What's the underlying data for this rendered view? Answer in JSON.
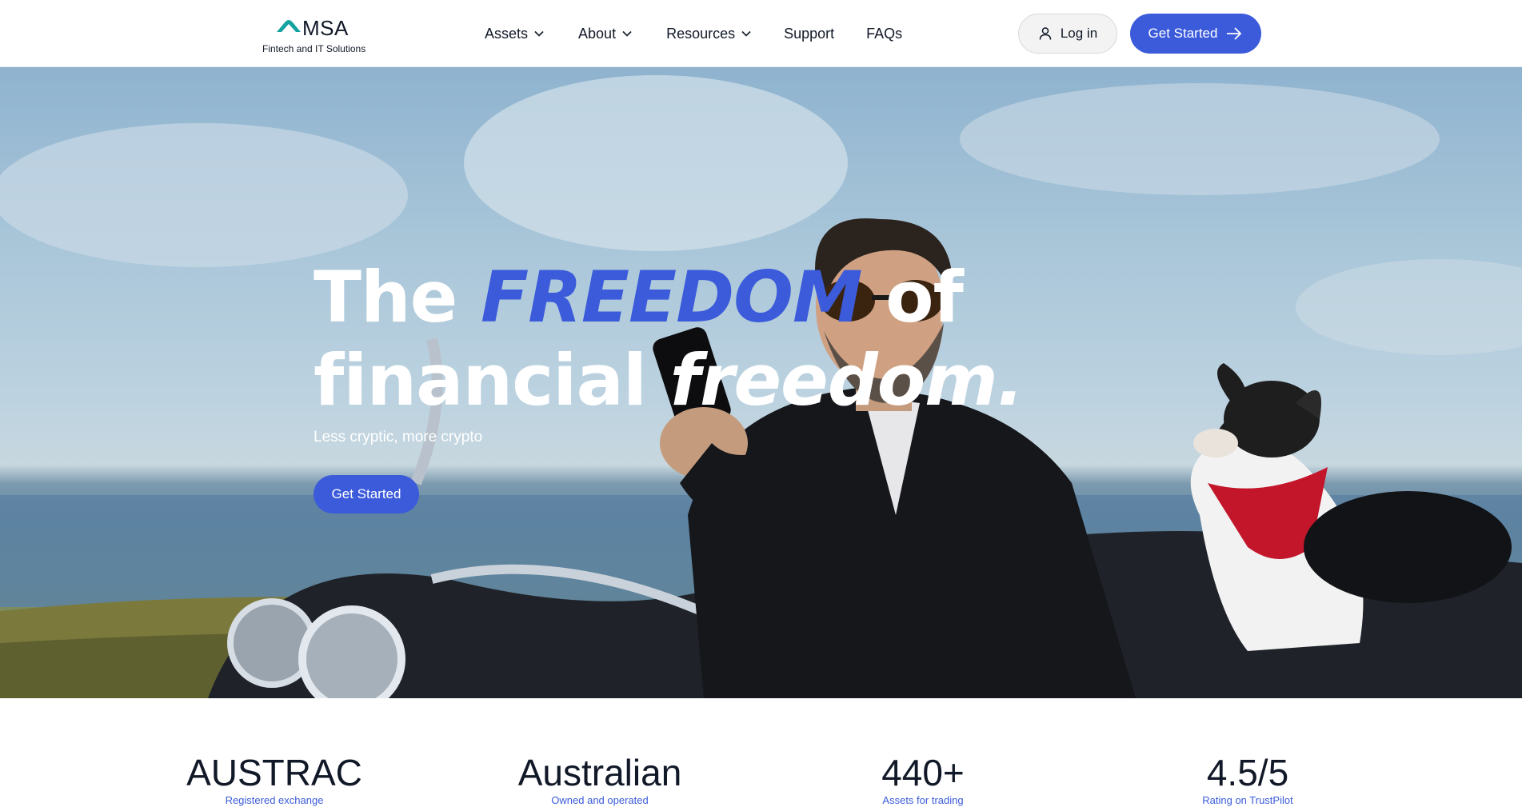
{
  "header": {
    "logo": {
      "name": "MSA",
      "tagline": "Fintech and IT Solutions",
      "mark_color": "#14a3a0"
    },
    "nav": [
      {
        "label": "Assets",
        "has_dropdown": true
      },
      {
        "label": "About",
        "has_dropdown": true
      },
      {
        "label": "Resources",
        "has_dropdown": true
      },
      {
        "label": "Support",
        "has_dropdown": false
      },
      {
        "label": "FAQs",
        "has_dropdown": false
      }
    ],
    "login_label": "Log in",
    "get_started_label": "Get Started",
    "icons": {
      "login": "user-icon",
      "get_started": "arrow-right-icon",
      "dropdown": "chevron-down-icon"
    }
  },
  "hero": {
    "title_part1": "The",
    "title_accent": "FREEDOM",
    "title_part2": "of",
    "title_line2": "financial",
    "title_italic": "freedom.",
    "subtitle": "Less cryptic, more crypto",
    "cta_label": "Get Started",
    "image_subject": "man in leather jacket on motorcycle with dog, ocean background"
  },
  "stats": [
    {
      "value": "AUSTRAC",
      "caption": "Registered exchange"
    },
    {
      "value": "Australian",
      "caption": "Owned and operated"
    },
    {
      "value": "440+",
      "caption": "Assets for trading"
    },
    {
      "value": "4.5/5",
      "caption": "Rating on TrustPilot"
    }
  ],
  "colors": {
    "brand_blue": "#3b5bdb",
    "teal": "#14a3a0",
    "text": "#111827"
  }
}
